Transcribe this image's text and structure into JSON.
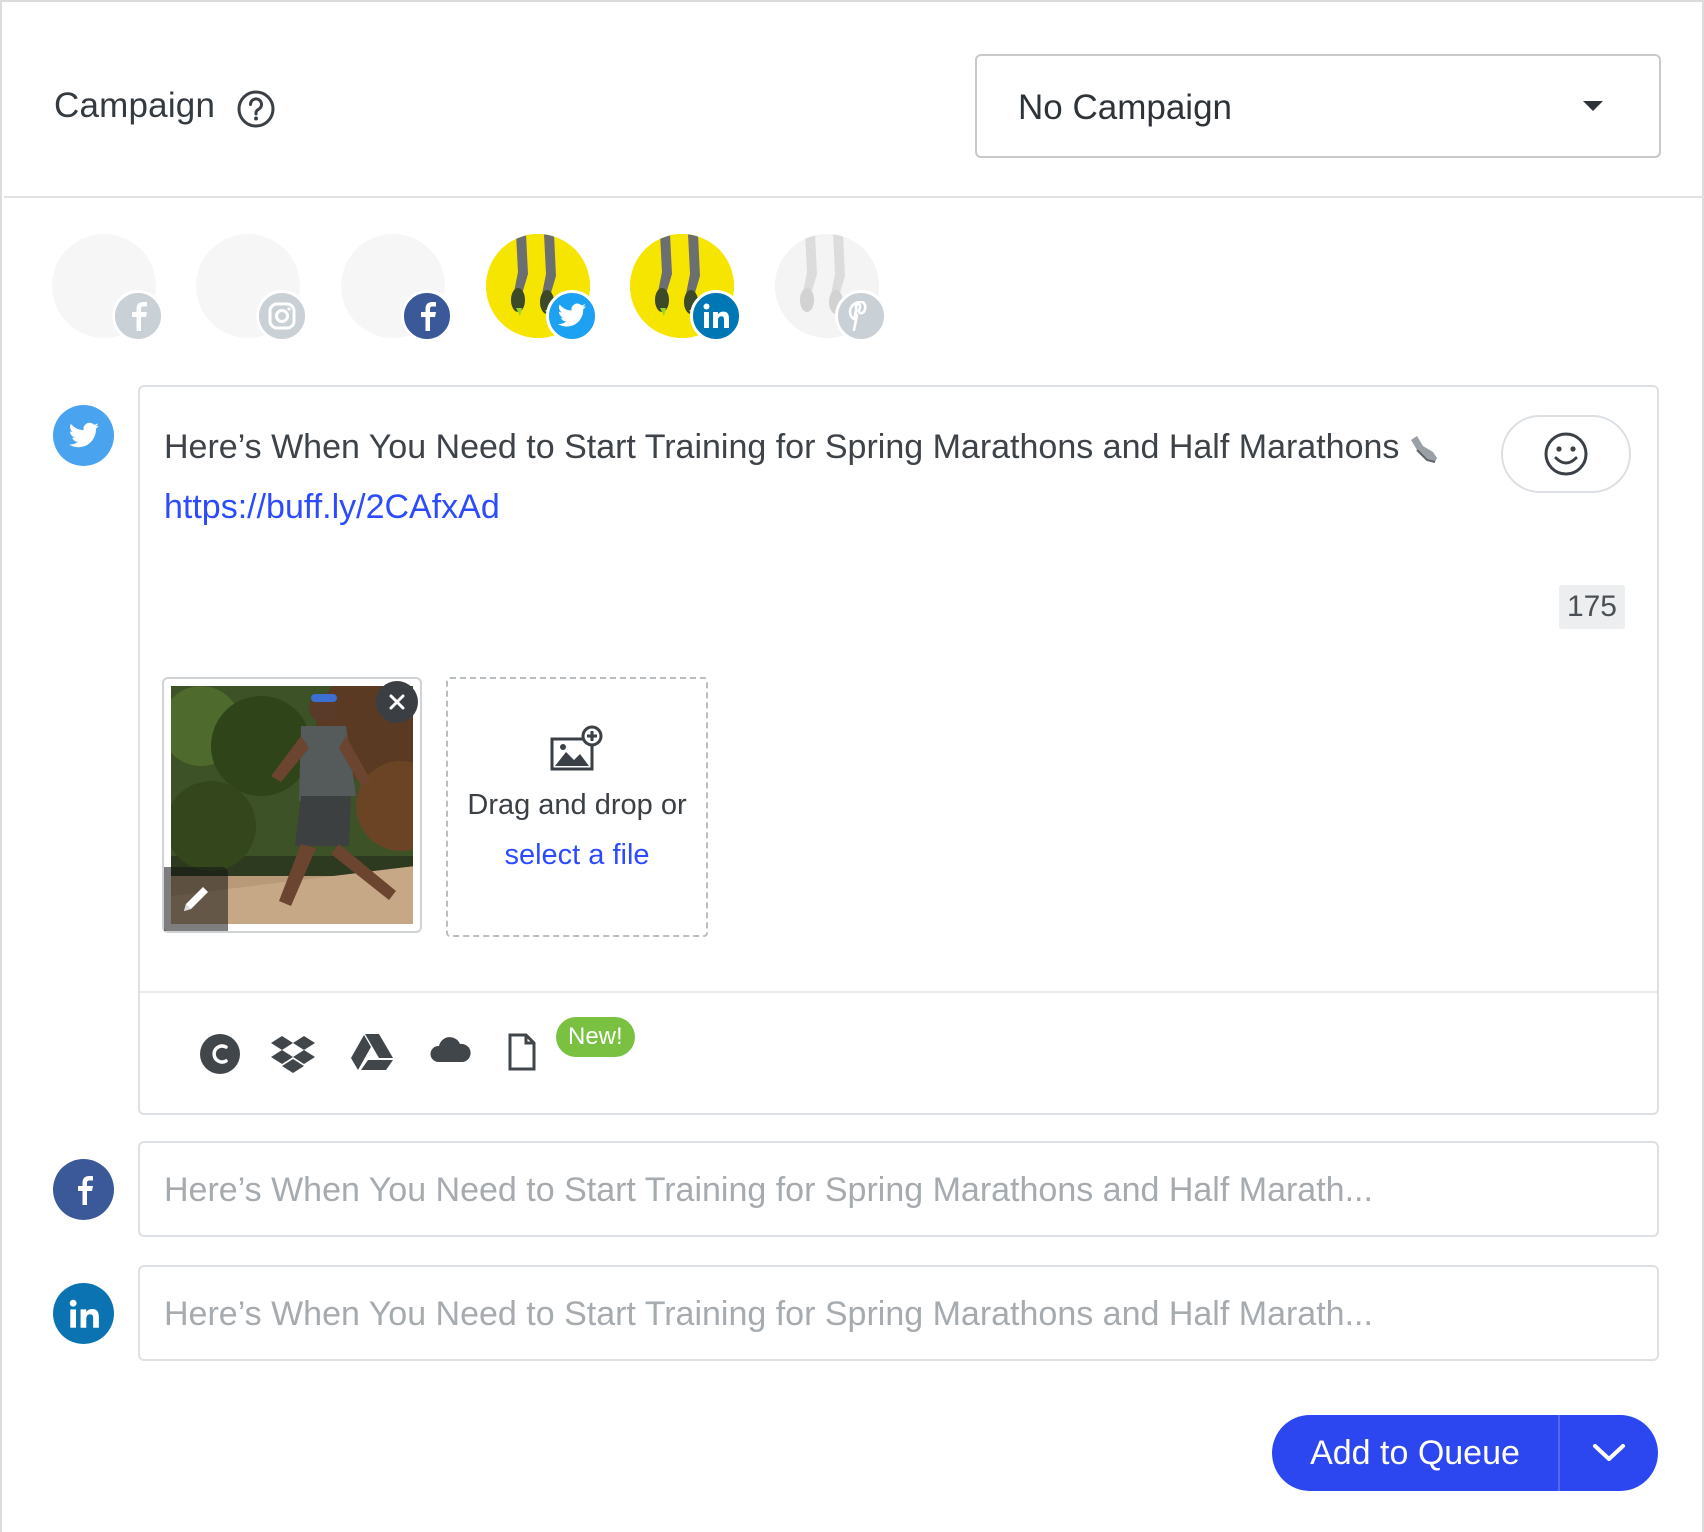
{
  "campaign": {
    "label": "Campaign",
    "selected": "No Campaign"
  },
  "profiles": [
    {
      "network": "facebook",
      "active": false
    },
    {
      "network": "instagram",
      "active": false
    },
    {
      "network": "facebook",
      "active": false
    },
    {
      "network": "twitter",
      "active": true
    },
    {
      "network": "linkedin",
      "active": true
    },
    {
      "network": "pinterest",
      "active": false
    }
  ],
  "composer": {
    "text": "Here’s When You Need to Start Training for Spring Marathons and Half Marathons",
    "link": "https://buff.ly/2CAfxAd",
    "char_count": "175",
    "dropzone_text": "Drag and drop or",
    "dropzone_link": "select a file",
    "new_badge": "New!"
  },
  "alt_posts": {
    "facebook": "Here’s When You Need to Start Training for Spring Marathons and Half Marath...",
    "linkedin": "Here’s When You Need to Start Training for Spring Marathons and Half Marath..."
  },
  "actions": {
    "primary": "Add to Queue"
  },
  "colors": {
    "accent": "#2c47f0",
    "twitter": "#1da1f2",
    "facebook": "#3b5998",
    "linkedin": "#0077b5",
    "new_badge": "#7ac142",
    "link": "#2c4bff"
  }
}
